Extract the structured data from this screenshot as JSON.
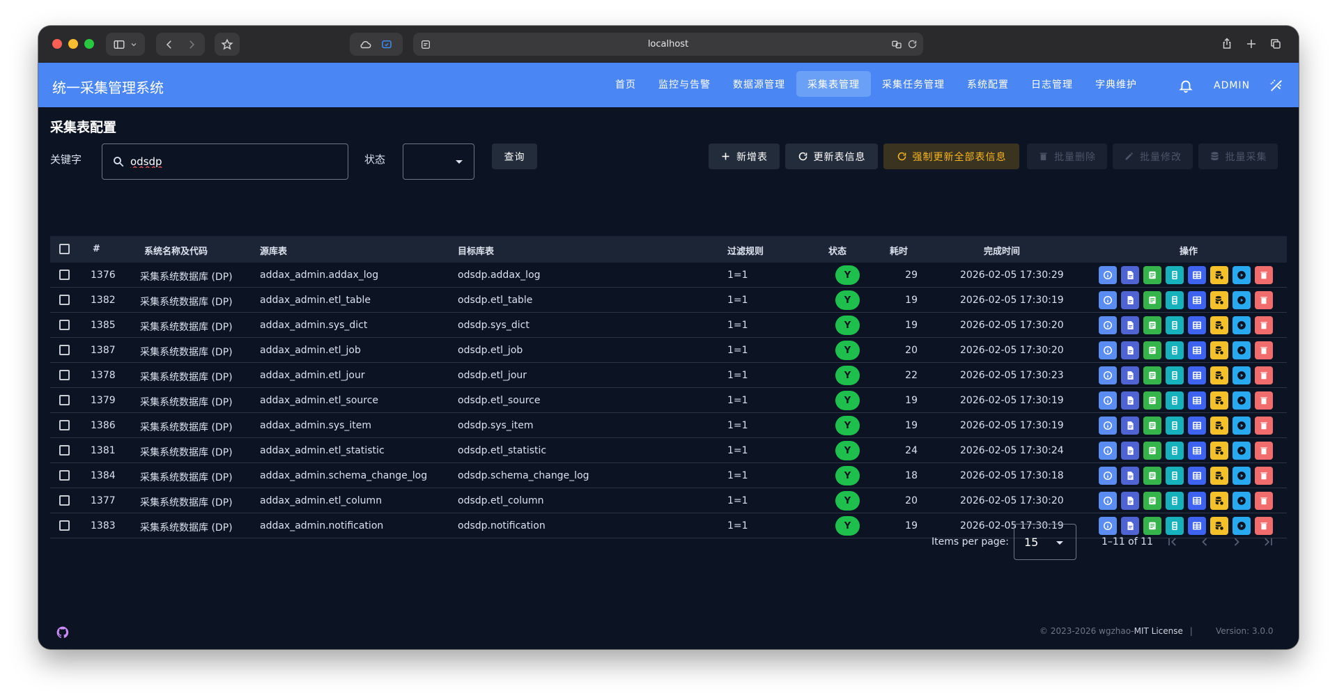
{
  "browser": {
    "url": "localhost"
  },
  "app": {
    "title": "统一采集管理系统",
    "nav": [
      {
        "label": "首页"
      },
      {
        "label": "监控与告警"
      },
      {
        "label": "数据源管理"
      },
      {
        "label": "采集表管理",
        "active": true
      },
      {
        "label": "采集任务管理"
      },
      {
        "label": "系统配置"
      },
      {
        "label": "日志管理"
      },
      {
        "label": "字典维护"
      }
    ],
    "user": "ADMIN",
    "header_color": "#4b87f4"
  },
  "page": {
    "title": "采集表配置",
    "filters": {
      "keyword_label": "关键字",
      "keyword_value": "odsdp",
      "status_label": "状态",
      "status_value": "",
      "query_button": "查询"
    },
    "toolbar": {
      "add": "新增表",
      "update_info": "更新表信息",
      "force_update_all": "强制更新全部表信息",
      "batch_delete": "批量删除",
      "batch_edit": "批量修改",
      "batch_collect": "批量采集"
    }
  },
  "table": {
    "headers": {
      "num": "#",
      "system": "系统名称及代码",
      "source": "源库表",
      "target": "目标库表",
      "filter": "过滤规则",
      "status": "状态",
      "duration": "耗时",
      "finish_time": "完成时间",
      "actions": "操作"
    },
    "rows": [
      {
        "id": "1376",
        "system": "采集系统数据库 (DP)",
        "source": "addax_admin.addax_log",
        "target": "odsdp.addax_log",
        "filter": "1=1",
        "status": "Y",
        "duration": "29",
        "finish_time": "2026-02-05 17:30:29"
      },
      {
        "id": "1382",
        "system": "采集系统数据库 (DP)",
        "source": "addax_admin.etl_table",
        "target": "odsdp.etl_table",
        "filter": "1=1",
        "status": "Y",
        "duration": "19",
        "finish_time": "2026-02-05 17:30:19"
      },
      {
        "id": "1385",
        "system": "采集系统数据库 (DP)",
        "source": "addax_admin.sys_dict",
        "target": "odsdp.sys_dict",
        "filter": "1=1",
        "status": "Y",
        "duration": "19",
        "finish_time": "2026-02-05 17:30:20"
      },
      {
        "id": "1387",
        "system": "采集系统数据库 (DP)",
        "source": "addax_admin.etl_job",
        "target": "odsdp.etl_job",
        "filter": "1=1",
        "status": "Y",
        "duration": "20",
        "finish_time": "2026-02-05 17:30:20"
      },
      {
        "id": "1378",
        "system": "采集系统数据库 (DP)",
        "source": "addax_admin.etl_jour",
        "target": "odsdp.etl_jour",
        "filter": "1=1",
        "status": "Y",
        "duration": "22",
        "finish_time": "2026-02-05 17:30:23"
      },
      {
        "id": "1379",
        "system": "采集系统数据库 (DP)",
        "source": "addax_admin.etl_source",
        "target": "odsdp.etl_source",
        "filter": "1=1",
        "status": "Y",
        "duration": "19",
        "finish_time": "2026-02-05 17:30:19"
      },
      {
        "id": "1386",
        "system": "采集系统数据库 (DP)",
        "source": "addax_admin.sys_item",
        "target": "odsdp.sys_item",
        "filter": "1=1",
        "status": "Y",
        "duration": "19",
        "finish_time": "2026-02-05 17:30:19"
      },
      {
        "id": "1381",
        "system": "采集系统数据库 (DP)",
        "source": "addax_admin.etl_statistic",
        "target": "odsdp.etl_statistic",
        "filter": "1=1",
        "status": "Y",
        "duration": "24",
        "finish_time": "2026-02-05 17:30:24"
      },
      {
        "id": "1384",
        "system": "采集系统数据库 (DP)",
        "source": "addax_admin.schema_change_log",
        "target": "odsdp.schema_change_log",
        "filter": "1=1",
        "status": "Y",
        "duration": "18",
        "finish_time": "2026-02-05 17:30:18"
      },
      {
        "id": "1377",
        "system": "采集系统数据库 (DP)",
        "source": "addax_admin.etl_column",
        "target": "odsdp.etl_column",
        "filter": "1=1",
        "status": "Y",
        "duration": "20",
        "finish_time": "2026-02-05 17:30:20"
      },
      {
        "id": "1383",
        "system": "采集系统数据库 (DP)",
        "source": "addax_admin.notification",
        "target": "odsdp.notification",
        "filter": "1=1",
        "status": "Y",
        "duration": "19",
        "finish_time": "2026-02-05 17:30:19"
      }
    ],
    "row_actions": [
      "info-icon",
      "file-icon",
      "document-icon",
      "column-list-icon",
      "table-grid-icon",
      "database-icon",
      "play-icon",
      "delete-icon"
    ]
  },
  "pager": {
    "items_per_page_label": "Items per page:",
    "page_size": "15",
    "range": "1–11 of 11"
  },
  "footer": {
    "copyright": "© 2023-2026 wgzhao-",
    "license": "MIT License",
    "separator": "|",
    "version": "Version: 3.0.0"
  }
}
